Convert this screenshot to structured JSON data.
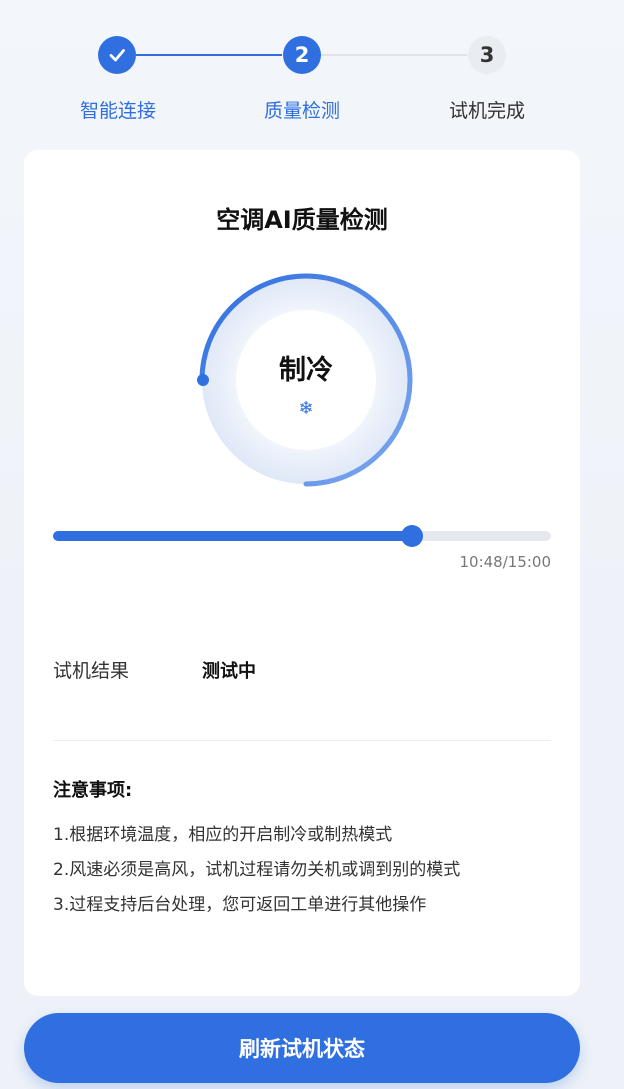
{
  "stepper": {
    "steps": [
      {
        "number": "",
        "label": "智能连接",
        "state": "done"
      },
      {
        "number": "2",
        "label": "质量检测",
        "state": "active"
      },
      {
        "number": "3",
        "label": "试机完成",
        "state": "pending"
      }
    ]
  },
  "card": {
    "title": "空调AI质量检测",
    "mode": "制冷",
    "mode_icon": "snowflake-icon",
    "mode_icon_glyph": "❄",
    "progress": {
      "elapsed": "10:48",
      "total": "15:00",
      "time_text": "10:48/15:00",
      "fraction": 0.72
    },
    "result": {
      "label": "试机结果",
      "value": "测试中"
    },
    "notes": {
      "title": "注意事项:",
      "items": [
        "1.根据环境温度，相应的开启制冷或制热模式",
        "2.风速必须是高风，试机过程请勿关机或调到别的模式",
        "3.过程支持后台处理，您可返回工单进行其他操作"
      ]
    }
  },
  "actions": {
    "refresh_label": "刷新试机状态"
  },
  "colors": {
    "accent": "#2f6fe0",
    "pending_step": "#e9ecf0",
    "track": "#e5e8ed"
  }
}
